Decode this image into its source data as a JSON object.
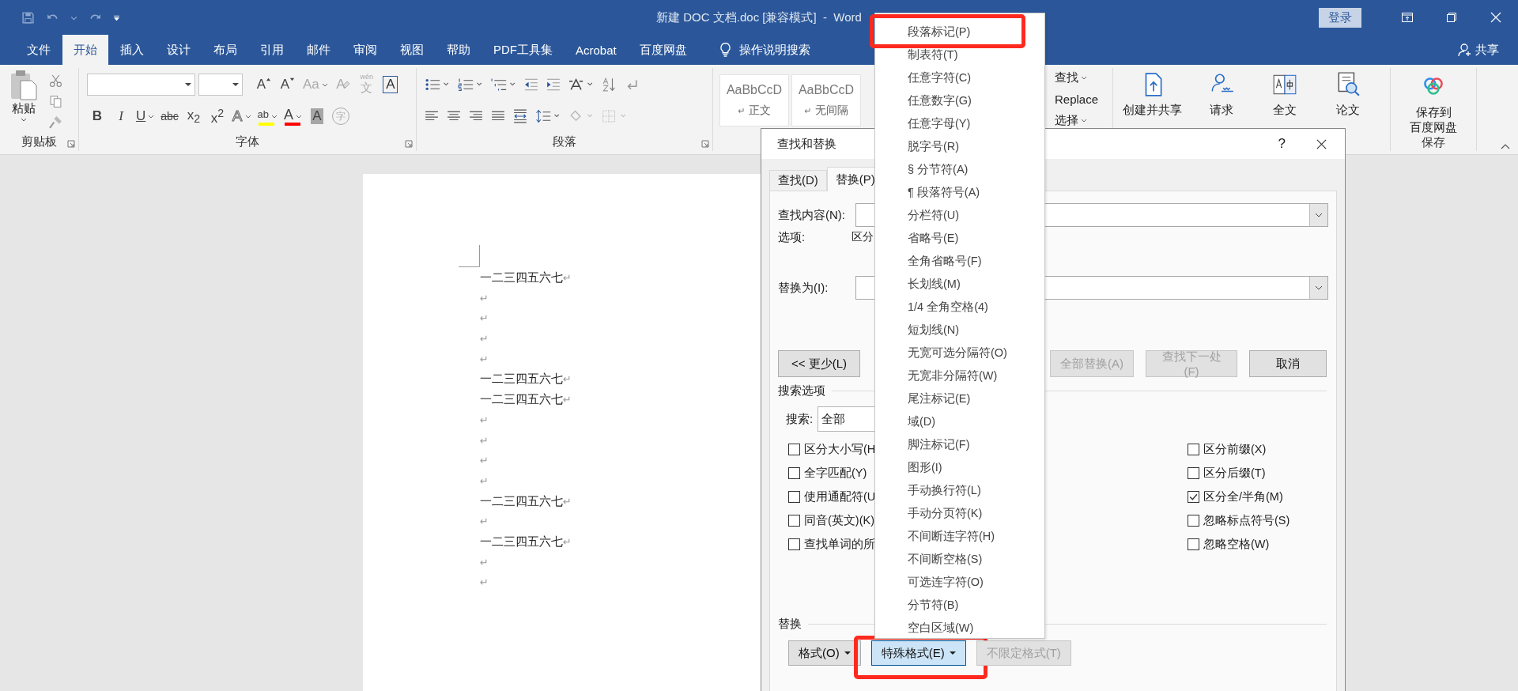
{
  "title_bar": {
    "title": "新建 DOC 文档.doc [兼容模式]  -  Word",
    "sign_in": "登录"
  },
  "ribbon_tabs": [
    {
      "label": "文件",
      "selected": false
    },
    {
      "label": "开始",
      "selected": true
    },
    {
      "label": "插入",
      "selected": false
    },
    {
      "label": "设计",
      "selected": false
    },
    {
      "label": "布局",
      "selected": false
    },
    {
      "label": "引用",
      "selected": false
    },
    {
      "label": "邮件",
      "selected": false
    },
    {
      "label": "审阅",
      "selected": false
    },
    {
      "label": "视图",
      "selected": false
    },
    {
      "label": "帮助",
      "selected": false
    },
    {
      "label": "PDF工具集",
      "selected": false
    },
    {
      "label": "Acrobat",
      "selected": false
    },
    {
      "label": "百度网盘",
      "selected": false
    }
  ],
  "tell_me": "操作说明搜索",
  "share": "共享",
  "ribbon": {
    "clipboard": {
      "paste": "粘贴",
      "label": "剪贴板"
    },
    "font": {
      "label": "字体",
      "row1": [
        {
          "kind": "grow",
          "glyph": "A",
          "caret": false,
          "disabled": false
        },
        {
          "kind": "shrink",
          "glyph": "A",
          "caret": false,
          "disabled": false
        },
        {
          "kind": "case",
          "glyph": "Aa",
          "caret": true,
          "disabled": true
        },
        {
          "kind": "clear",
          "glyph": "A",
          "caret": false,
          "disabled": true
        },
        {
          "kind": "phonetic",
          "glyph": "文",
          "ruby": "wén",
          "caret": false,
          "disabled": true
        },
        {
          "kind": "boxed",
          "glyph": "A",
          "caret": false,
          "disabled": false
        }
      ],
      "row2": [
        {
          "kind": "bold",
          "glyph": "B",
          "caret": false,
          "disabled": false
        },
        {
          "kind": "italic",
          "glyph": "I",
          "caret": false,
          "disabled": false
        },
        {
          "kind": "underline",
          "glyph": "U",
          "caret": true,
          "disabled": false
        },
        {
          "kind": "strike",
          "glyph": "abc",
          "caret": false,
          "disabled": false
        },
        {
          "kind": "sub",
          "glyph": "x$_{2}$",
          "caret": false,
          "disabled": false
        },
        {
          "kind": "sup",
          "glyph": "x$^{2}$",
          "caret": false,
          "disabled": false
        },
        {
          "kind": "outline",
          "glyph": "A",
          "caret": true,
          "disabled": true
        },
        {
          "kind": "highlight",
          "glyph": "ab",
          "color": "#ffff00",
          "caret": true,
          "disabled": false
        },
        {
          "kind": "color",
          "glyph": "A",
          "color": "#ff0000",
          "caret": true,
          "disabled": false
        },
        {
          "kind": "shaded",
          "glyph": "A",
          "caret": false,
          "disabled": false
        },
        {
          "kind": "circled",
          "glyph": "字",
          "caret": false,
          "disabled": true
        }
      ]
    },
    "paragraph": {
      "label": "段落"
    },
    "styles": [
      {
        "sample": "AaBbCcD",
        "mark": "↵",
        "name": "正文"
      },
      {
        "sample": "AaBbCcD",
        "mark": "↵",
        "name": "无间隔"
      }
    ],
    "editing": [
      {
        "label": "查找",
        "caret": true
      },
      {
        "label": "Replace",
        "caret": false
      },
      {
        "label": "选择",
        "caret": true
      }
    ],
    "commands": [
      {
        "label": "创建并共享"
      },
      {
        "label": "请求"
      },
      {
        "label": "全文"
      },
      {
        "label": "论文"
      }
    ],
    "save": {
      "lines": [
        "保存到",
        "百度网盘"
      ],
      "label": "保存"
    }
  },
  "document": {
    "lines": [
      {
        "text": "一二三四五六七",
        "mark": "↵"
      },
      {
        "mark": "↵"
      },
      {
        "mark": "↵"
      },
      {
        "mark": "↵"
      },
      {
        "mark": "↵"
      },
      {
        "text": "一二三四五六七",
        "mark": "↵"
      },
      {
        "text": "一二三四五六七",
        "mark": "↵"
      },
      {
        "mark": "↵"
      },
      {
        "mark": "↵"
      },
      {
        "mark": "↵"
      },
      {
        "mark": "↵"
      },
      {
        "text": "一二三四五六七",
        "mark": "↵"
      },
      {
        "mark": "↵"
      },
      {
        "text": "一二三四五六七",
        "mark": "↵"
      },
      {
        "mark": "↵"
      },
      {
        "mark": "↵"
      }
    ]
  },
  "dialog": {
    "title": "查找和替换",
    "help": "?",
    "tabs": [
      {
        "label": "查找(D)",
        "selected": false
      },
      {
        "label": "替换(P)",
        "selected": true
      }
    ],
    "find_label": "查找内容(N):",
    "options_label": "选项:",
    "options_value": "区分",
    "replace_label": "替换为(I):",
    "buttons": [
      {
        "label": "<< 更少(L)",
        "disabled": false
      },
      {
        "label": "全部替换(A)",
        "disabled": true
      },
      {
        "label": "查找下一处(F)",
        "disabled": true
      },
      {
        "label": "取消",
        "disabled": false
      }
    ],
    "search_options_label": "搜索选项",
    "search_label": "搜索:",
    "search_value": "全部",
    "left_options": [
      {
        "label": "区分大小写(H",
        "checked": false
      },
      {
        "label": "全字匹配(Y)",
        "checked": false
      },
      {
        "label": "使用通配符(U",
        "checked": false
      },
      {
        "label": "同音(英文)(K)",
        "checked": false
      },
      {
        "label": "查找单词的所",
        "checked": false
      }
    ],
    "right_options": [
      {
        "label": "区分前缀(X)",
        "checked": false
      },
      {
        "label": "区分后缀(T)",
        "checked": false
      },
      {
        "label": "区分全/半角(M)",
        "checked": true
      },
      {
        "label": "忽略标点符号(S)",
        "checked": false
      },
      {
        "label": "忽略空格(W)",
        "checked": false
      }
    ],
    "replace_section_label": "替换",
    "format_buttons": [
      {
        "label": "格式(O)",
        "dropdown": true,
        "disabled": false,
        "pressed": false,
        "highlighted": false
      },
      {
        "label": "特殊格式(E)",
        "dropdown": true,
        "disabled": false,
        "pressed": true,
        "highlighted": true
      },
      {
        "label": "不限定格式(T)",
        "dropdown": false,
        "disabled": true,
        "pressed": false,
        "highlighted": false
      }
    ]
  },
  "special_menu": {
    "items": [
      {
        "label": "段落标记(P)",
        "highlighted": true
      },
      {
        "label": "制表符(T)",
        "highlighted": false
      },
      {
        "label": "任意字符(C)",
        "highlighted": false
      },
      {
        "label": "任意数字(G)",
        "highlighted": false
      },
      {
        "label": "任意字母(Y)",
        "highlighted": false
      },
      {
        "label": "脱字号(R)",
        "highlighted": false
      },
      {
        "label": "§ 分节符(A)",
        "highlighted": false
      },
      {
        "label": "¶ 段落符号(A)",
        "highlighted": false
      },
      {
        "label": "分栏符(U)",
        "highlighted": false
      },
      {
        "label": "省略号(E)",
        "highlighted": false
      },
      {
        "label": "全角省略号(F)",
        "highlighted": false
      },
      {
        "label": "长划线(M)",
        "highlighted": false
      },
      {
        "label": "1/4 全角空格(4)",
        "highlighted": false
      },
      {
        "label": "短划线(N)",
        "highlighted": false
      },
      {
        "label": "无宽可选分隔符(O)",
        "highlighted": false
      },
      {
        "label": "无宽非分隔符(W)",
        "highlighted": false
      },
      {
        "label": "尾注标记(E)",
        "highlighted": false
      },
      {
        "label": "域(D)",
        "highlighted": false
      },
      {
        "label": "脚注标记(F)",
        "highlighted": false
      },
      {
        "label": "图形(I)",
        "highlighted": false
      },
      {
        "label": "手动换行符(L)",
        "highlighted": false
      },
      {
        "label": "手动分页符(K)",
        "highlighted": false
      },
      {
        "label": "不间断连字符(H)",
        "highlighted": false
      },
      {
        "label": "不间断空格(S)",
        "highlighted": false
      },
      {
        "label": "可选连字符(O)",
        "highlighted": false
      },
      {
        "label": "分节符(B)",
        "highlighted": false
      },
      {
        "label": "空白区域(W)",
        "highlighted": false
      }
    ]
  }
}
